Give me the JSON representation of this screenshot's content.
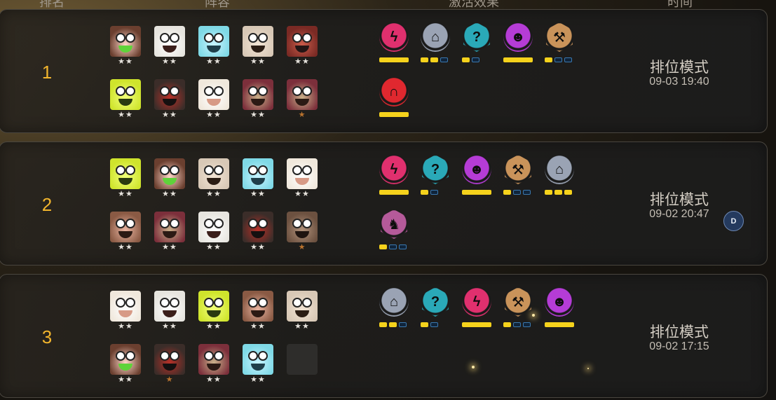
{
  "header": {
    "rank": "排名",
    "lineup": "阵容",
    "synergy": "激活效果",
    "time": "时间"
  },
  "records": [
    {
      "rank": "1",
      "mode": "排位模式",
      "time": "09-03 19:40",
      "units": [
        {
          "name": "green-horn-pig",
          "stars": "★★",
          "star_tier": "silver",
          "colors": [
            "#6b3f2f",
            "#ffd5c8",
            "#5fd33a"
          ]
        },
        {
          "name": "white-furred-beast",
          "stars": "★★",
          "star_tier": "silver",
          "colors": [
            "#e7e5df",
            "#ffffff",
            "#3a1e1a"
          ]
        },
        {
          "name": "ice-yeti",
          "stars": "★★",
          "star_tier": "silver",
          "colors": [
            "#7fd9e6",
            "#c8f4ff",
            "#1f3f4a"
          ]
        },
        {
          "name": "bald-monk",
          "stars": "★★",
          "star_tier": "silver",
          "colors": [
            "#d8c8b6",
            "#f2e4d4",
            "#2b1d14"
          ]
        },
        {
          "name": "red-helmet-warrior",
          "stars": "★★",
          "star_tier": "silver",
          "colors": [
            "#7a2a24",
            "#c95b4a",
            "#231515"
          ]
        },
        {
          "name": "yellow-lizard",
          "stars": "★★",
          "star_tier": "silver",
          "colors": [
            "#cfe42c",
            "#f1ff7a",
            "#2a3a10"
          ]
        },
        {
          "name": "red-hat-bearded",
          "stars": "★★",
          "star_tier": "silver",
          "colors": [
            "#3b2d29",
            "#b83028",
            "#151010"
          ]
        },
        {
          "name": "sheep",
          "stars": "★★",
          "star_tier": "silver",
          "colors": [
            "#f0e8dc",
            "#ffffff",
            "#d79a86"
          ]
        },
        {
          "name": "horned-berserker",
          "stars": "★★",
          "star_tier": "silver",
          "colors": [
            "#7c2f3b",
            "#c9b08a",
            "#2b1a14"
          ]
        },
        {
          "name": "horned-berserker",
          "stars": "★",
          "star_tier": "bronze",
          "colors": [
            "#7c2f3b",
            "#c9b08a",
            "#2b1a14"
          ]
        }
      ],
      "synergies": [
        {
          "name": "dragon",
          "icon": "dragon-icon",
          "glyph": "ϟ",
          "shape": "circle",
          "color": "#e0306e",
          "bars": "full"
        },
        {
          "name": "guardian",
          "icon": "guardian-icon",
          "glyph": "⌂",
          "shape": "circle",
          "color": "#9aa3b4",
          "bars": [
            1,
            1,
            0
          ]
        },
        {
          "name": "mystic",
          "icon": "mystic-icon",
          "glyph": "?",
          "shape": "hex",
          "color": "#2aa9b8",
          "bars": [
            1,
            0
          ]
        },
        {
          "name": "demon",
          "icon": "demon-icon",
          "glyph": "☻",
          "shape": "circle",
          "color": "#b53cd6",
          "bars": "full"
        },
        {
          "name": "warrior",
          "icon": "axe-icon",
          "glyph": "⚒",
          "shape": "hex",
          "color": "#c9935a",
          "bars": [
            1,
            0,
            0
          ]
        },
        {
          "name": "predator",
          "icon": "predator-icon",
          "glyph": "∩",
          "shape": "circle",
          "color": "#e0282f",
          "bars": "full"
        }
      ]
    },
    {
      "rank": "2",
      "mode": "排位模式",
      "time": "09-02 20:47",
      "units": [
        {
          "name": "yellow-lizard",
          "stars": "★★",
          "star_tier": "silver",
          "colors": [
            "#cfe42c",
            "#f1ff7a",
            "#2a3a10"
          ]
        },
        {
          "name": "green-horn-pig",
          "stars": "★★",
          "star_tier": "silver",
          "colors": [
            "#6b3f2f",
            "#ffd5c8",
            "#5fd33a"
          ]
        },
        {
          "name": "bald-monk",
          "stars": "★★",
          "star_tier": "silver",
          "colors": [
            "#d8c8b6",
            "#f2e4d4",
            "#2b1d14"
          ]
        },
        {
          "name": "ice-yeti",
          "stars": "★★",
          "star_tier": "silver",
          "colors": [
            "#7fd9e6",
            "#c8f4ff",
            "#1f3f4a"
          ]
        },
        {
          "name": "sheep",
          "stars": "★★",
          "star_tier": "silver",
          "colors": [
            "#f0e8dc",
            "#ffffff",
            "#d79a86"
          ]
        },
        {
          "name": "boar",
          "stars": "★★",
          "star_tier": "silver",
          "colors": [
            "#8a5a44",
            "#e9b4a0",
            "#2b1a14"
          ]
        },
        {
          "name": "horned-berserker",
          "stars": "★★",
          "star_tier": "silver",
          "colors": [
            "#7c2f3b",
            "#c9b08a",
            "#2b1a14"
          ]
        },
        {
          "name": "white-furred-beast",
          "stars": "★★",
          "star_tier": "silver",
          "colors": [
            "#e7e5df",
            "#ffffff",
            "#3a1e1a"
          ]
        },
        {
          "name": "red-hat-bearded",
          "stars": "★★",
          "star_tier": "silver",
          "colors": [
            "#3b2d29",
            "#b83028",
            "#151010"
          ]
        },
        {
          "name": "shaggy-dog",
          "stars": "★",
          "star_tier": "bronze",
          "colors": [
            "#6c5140",
            "#b0917a",
            "#1e1410"
          ]
        }
      ],
      "synergies": [
        {
          "name": "dragon",
          "icon": "dragon-icon",
          "glyph": "ϟ",
          "shape": "circle",
          "color": "#e0306e",
          "bars": "full"
        },
        {
          "name": "mystic",
          "icon": "mystic-icon",
          "glyph": "?",
          "shape": "hex",
          "color": "#2aa9b8",
          "bars": [
            1,
            0
          ]
        },
        {
          "name": "demon",
          "icon": "demon-icon",
          "glyph": "☻",
          "shape": "circle",
          "color": "#b53cd6",
          "bars": "full"
        },
        {
          "name": "warrior",
          "icon": "axe-icon",
          "glyph": "⚒",
          "shape": "hex",
          "color": "#c9935a",
          "bars": [
            1,
            0,
            0
          ]
        },
        {
          "name": "guardian",
          "icon": "guardian-icon",
          "glyph": "⌂",
          "shape": "circle",
          "color": "#9aa3b4",
          "bars": [
            1,
            1,
            1
          ]
        },
        {
          "name": "knight",
          "icon": "knight-icon",
          "glyph": "♞",
          "shape": "hex",
          "color": "#b55a9a",
          "bars": [
            1,
            0,
            0
          ]
        }
      ],
      "badge": "D"
    },
    {
      "rank": "3",
      "mode": "排位模式",
      "time": "09-02 17:15",
      "units": [
        {
          "name": "sheep",
          "stars": "★★",
          "star_tier": "silver",
          "colors": [
            "#f0e8dc",
            "#ffffff",
            "#d79a86"
          ]
        },
        {
          "name": "white-furred-beast",
          "stars": "★★",
          "star_tier": "silver",
          "colors": [
            "#e7e5df",
            "#ffffff",
            "#3a1e1a"
          ]
        },
        {
          "name": "yellow-lizard",
          "stars": "★★",
          "star_tier": "silver",
          "colors": [
            "#cfe42c",
            "#f1ff7a",
            "#2a3a10"
          ]
        },
        {
          "name": "boar",
          "stars": "★★",
          "star_tier": "silver",
          "colors": [
            "#8a5a44",
            "#e9b4a0",
            "#2b1a14"
          ]
        },
        {
          "name": "bald-monk",
          "stars": "★★",
          "star_tier": "silver",
          "colors": [
            "#d8c8b6",
            "#f2e4d4",
            "#2b1d14"
          ]
        },
        {
          "name": "green-horn-pig",
          "stars": "★★",
          "star_tier": "silver",
          "colors": [
            "#6b3f2f",
            "#ffd5c8",
            "#5fd33a"
          ]
        },
        {
          "name": "red-hat-bearded",
          "stars": "★",
          "star_tier": "bronze",
          "colors": [
            "#3b2d29",
            "#b83028",
            "#151010"
          ]
        },
        {
          "name": "horned-berserker",
          "stars": "★★",
          "star_tier": "silver",
          "colors": [
            "#7c2f3b",
            "#c9b08a",
            "#2b1a14"
          ]
        },
        {
          "name": "ice-yeti",
          "stars": "★★",
          "star_tier": "silver",
          "colors": [
            "#7fd9e6",
            "#c8f4ff",
            "#1f3f4a"
          ]
        },
        {
          "name": "empty-slot",
          "stars": "",
          "star_tier": "none",
          "colors": []
        }
      ],
      "synergies": [
        {
          "name": "guardian",
          "icon": "guardian-icon",
          "glyph": "⌂",
          "shape": "circle",
          "color": "#9aa3b4",
          "bars": [
            1,
            1,
            0
          ]
        },
        {
          "name": "mystic",
          "icon": "mystic-icon",
          "glyph": "?",
          "shape": "hex",
          "color": "#2aa9b8",
          "bars": [
            1,
            0
          ]
        },
        {
          "name": "dragon",
          "icon": "dragon-icon",
          "glyph": "ϟ",
          "shape": "circle",
          "color": "#e0306e",
          "bars": "full"
        },
        {
          "name": "warrior",
          "icon": "axe-icon",
          "glyph": "⚒",
          "shape": "hex",
          "color": "#c9935a",
          "bars": [
            1,
            0,
            0
          ]
        },
        {
          "name": "demon",
          "icon": "demon-icon",
          "glyph": "☻",
          "shape": "circle",
          "color": "#b53cd6",
          "bars": "full"
        }
      ]
    }
  ]
}
